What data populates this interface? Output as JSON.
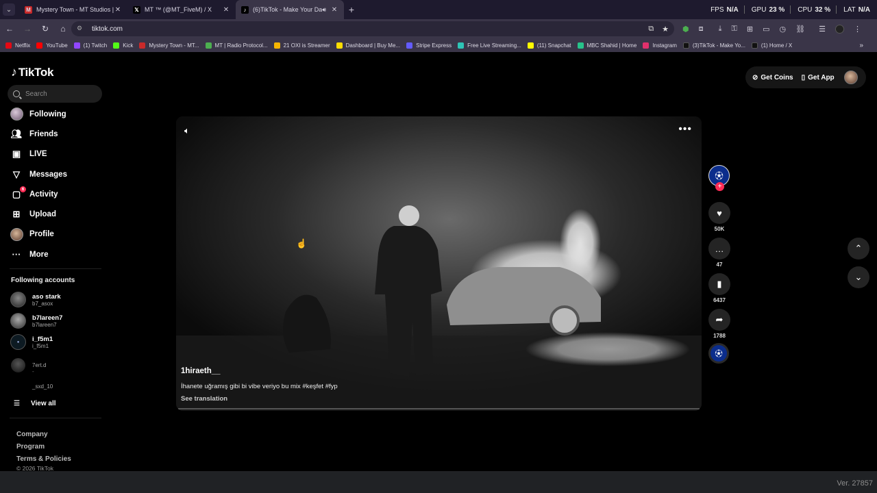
{
  "browser": {
    "tabs": [
      {
        "title": "Mystery Town - MT Studios | M",
        "favicon_color": "#c92a2a",
        "active": false
      },
      {
        "title": "MT ™ (@MT_FiveM) / X",
        "favicon_color": "#000000",
        "favicon_glyph": "𝕏",
        "active": false
      },
      {
        "title": "(6)TikTok - Make Your Day",
        "favicon_color": "#000000",
        "favicon_glyph": "♪",
        "active": true
      }
    ],
    "perf": {
      "fps_label": "FPS",
      "fps_value": "N/A",
      "gpu_label": "GPU",
      "gpu_value": "23 %",
      "cpu_label": "CPU",
      "cpu_value": "32 %",
      "lat_label": "LAT",
      "lat_value": "N/A"
    },
    "url": "tiktok.com",
    "bookmarks": [
      {
        "label": "Netflix",
        "color": "#e50914"
      },
      {
        "label": "YouTube",
        "color": "#ff0000"
      },
      {
        "label": "(1) Twitch",
        "color": "#9146ff"
      },
      {
        "label": "Kick",
        "color": "#53fc18"
      },
      {
        "label": "Mystery Town - MT...",
        "color": "#c92a2a"
      },
      {
        "label": "MT | Radio Protocol...",
        "color": "#4caf50"
      },
      {
        "label": "21 OXI is Streamer",
        "color": "#f5b400"
      },
      {
        "label": "Dashboard | Buy Me...",
        "color": "#ffdd00"
      },
      {
        "label": "Stripe Express",
        "color": "#635bff"
      },
      {
        "label": "Free Live Streaming...",
        "color": "#2ec4b6"
      },
      {
        "label": "(11) Snapchat",
        "color": "#fffc00"
      },
      {
        "label": "MBC Shahid | Home",
        "color": "#27c28a"
      },
      {
        "label": "Instagram",
        "color": "#e1306c"
      },
      {
        "label": "(3)TikTok - Make Yo...",
        "color": "#000000"
      },
      {
        "label": "(1) Home / X",
        "color": "#000000"
      }
    ]
  },
  "tiktok": {
    "logo": "TikTok",
    "search_placeholder": "Search",
    "nav": [
      {
        "label": "Following",
        "icon": "following-avatar"
      },
      {
        "label": "Friends",
        "icon": "friends-icon"
      },
      {
        "label": "LIVE",
        "icon": "live-icon"
      },
      {
        "label": "Messages",
        "icon": "messages-icon"
      },
      {
        "label": "Activity",
        "icon": "activity-icon",
        "badge": "6"
      },
      {
        "label": "Upload",
        "icon": "upload-icon"
      },
      {
        "label": "Profile",
        "icon": "profile-avatar"
      },
      {
        "label": "More",
        "icon": "more-icon"
      }
    ],
    "following_header": "Following accounts",
    "following": [
      {
        "name": "aso stark",
        "handle": "b7_asox"
      },
      {
        "name": "b7lareen7",
        "handle": "b7lareen7"
      },
      {
        "name": "i_f5m1",
        "handle": "i_f5m1"
      },
      {
        "name": "-",
        "handle": "7ert.d"
      },
      {
        "name": "-",
        "handle": "_sxd_10"
      }
    ],
    "view_all": "View all",
    "footer": [
      "Company",
      "Program",
      "Terms & Policies"
    ],
    "copyright": "© 2026 TikTok",
    "top_right": {
      "coins": "Get Coins",
      "app": "Get App"
    },
    "video": {
      "author": "1hiraeth__",
      "caption": "İhanete uğramış gibi bi vibe veriyo bu mix #keşfet #fyp",
      "see_translation": "See translation"
    },
    "actions": {
      "likes": "50K",
      "comments": "47",
      "saves": "6437",
      "shares": "1788"
    }
  },
  "version": "Ver. 27857"
}
